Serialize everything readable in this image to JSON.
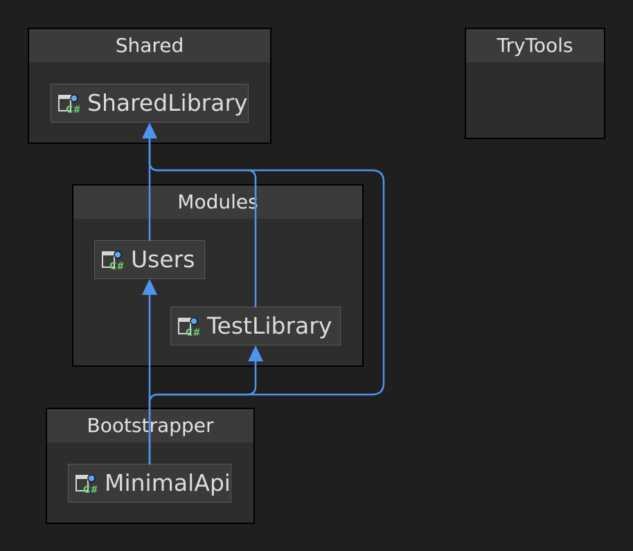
{
  "groups": {
    "shared": {
      "title": "Shared"
    },
    "trytools": {
      "title": "TryTools"
    },
    "modules": {
      "title": "Modules"
    },
    "bootstrapper": {
      "title": "Bootstrapper"
    }
  },
  "projects": {
    "shared_library": {
      "name": "SharedLibrary",
      "icon": "csharp-project-icon"
    },
    "users": {
      "name": "Users",
      "icon": "csharp-project-icon"
    },
    "test_library": {
      "name": "TestLibrary",
      "icon": "csharp-project-icon"
    },
    "minimal_api": {
      "name": "MinimalApi",
      "icon": "csharp-project-icon"
    }
  },
  "dependencies": [
    {
      "from": "Users",
      "to": "SharedLibrary"
    },
    {
      "from": "TestLibrary",
      "to": "SharedLibrary"
    },
    {
      "from": "MinimalApi",
      "to": "SharedLibrary"
    },
    {
      "from": "MinimalApi",
      "to": "Users"
    },
    {
      "from": "MinimalApi",
      "to": "TestLibrary"
    }
  ],
  "colors": {
    "background": "#1f1f1f",
    "group_fill": "#2d2d2d",
    "group_header": "#3b3b3b",
    "node_fill": "#3a3a3a",
    "edge": "#4f94ef",
    "csharp_badge": "#6ccf6c",
    "ref_dot": "#5aa7f5"
  }
}
